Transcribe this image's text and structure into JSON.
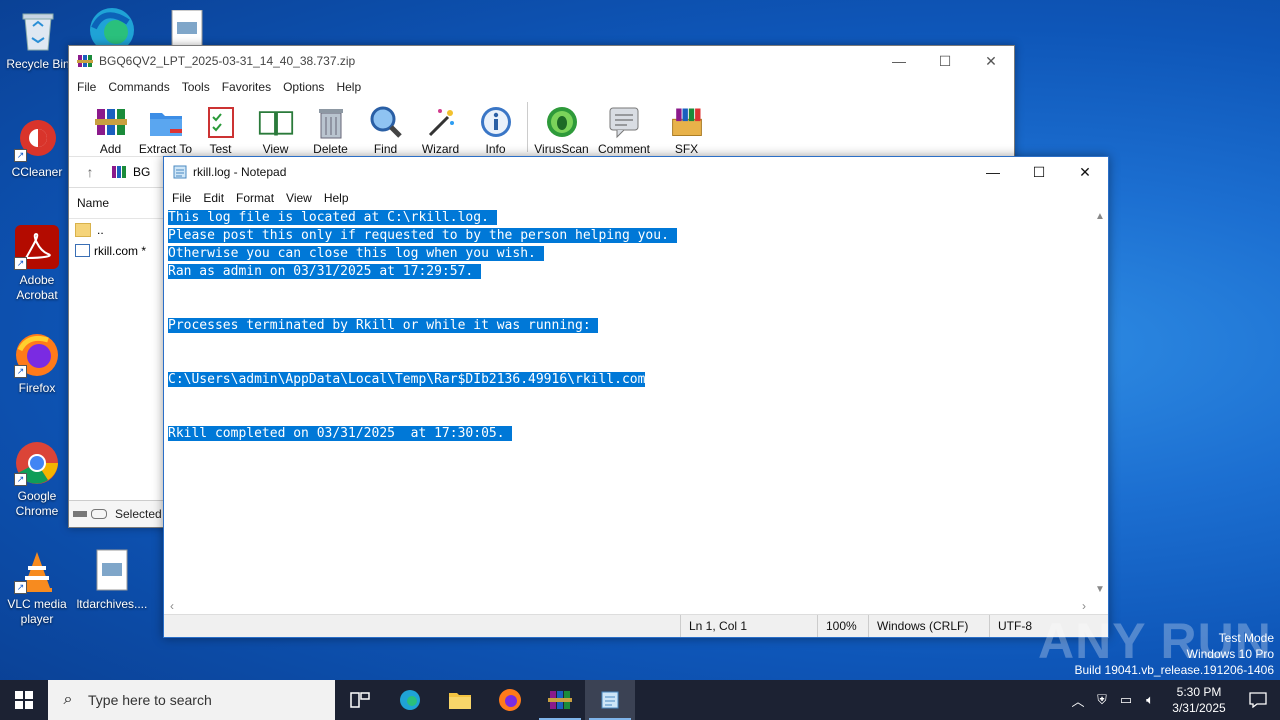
{
  "desktop": {
    "icons": [
      {
        "label": "Recycle Bin"
      },
      {
        "label": "CCleaner"
      },
      {
        "label": "Adobe Acrobat"
      },
      {
        "label": "Firefox"
      },
      {
        "label": "Google Chrome"
      },
      {
        "label": "VLC media player"
      },
      {
        "label": "ltdarchives...."
      }
    ]
  },
  "winrar": {
    "title": "BGQ6QV2_LPT_2025-03-31_14_40_38.737.zip",
    "menu": [
      "File",
      "Commands",
      "Tools",
      "Favorites",
      "Options",
      "Help"
    ],
    "toolbar": [
      "Add",
      "Extract To",
      "Test",
      "View",
      "Delete",
      "Find",
      "Wizard",
      "Info",
      "VirusScan",
      "Comment",
      "SFX"
    ],
    "path_text": "BG",
    "list_header": "Name",
    "files": [
      "..",
      "rkill.com *"
    ],
    "status": "Selected"
  },
  "notepad": {
    "title": "rkill.log - Notepad",
    "menu": [
      "File",
      "Edit",
      "Format",
      "View",
      "Help"
    ],
    "lines": [
      "This log file is located at C:\\rkill.log.",
      "Please post this only if requested to by the person helping you.",
      "Otherwise you can close this log when you wish.",
      "Ran as admin on 03/31/2025 at 17:29:57.",
      "",
      "",
      "Processes terminated by Rkill or while it was running:",
      "",
      "",
      "C:\\Users\\admin\\AppData\\Local\\Temp\\Rar$DIb2136.49916\\rkill.com",
      "",
      "",
      "Rkill completed on 03/31/2025  at 17:30:05."
    ],
    "status": {
      "position": "Ln 1, Col 1",
      "zoom": "100%",
      "line_ending": "Windows (CRLF)",
      "encoding": "UTF-8"
    }
  },
  "watermark": "ANY RUN",
  "windows_info": {
    "line1": "Test Mode",
    "line2": "Windows 10 Pro",
    "line3": "Build 19041.vb_release.191206-1406"
  },
  "taskbar": {
    "search_placeholder": "Type here to search",
    "time": "5:30 PM",
    "date": "3/31/2025"
  }
}
